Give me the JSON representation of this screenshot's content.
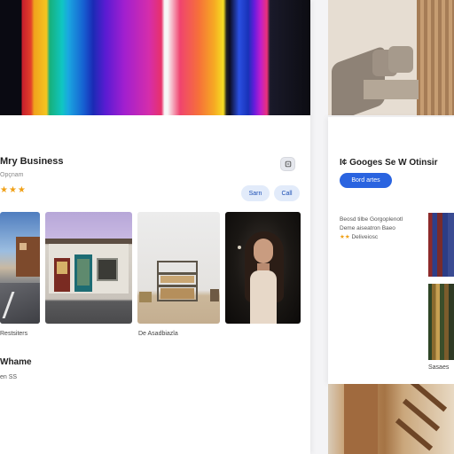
{
  "left_card": {
    "business_name": "Mry Business",
    "subtitle": "Opçnam",
    "rating_stars": "★★★",
    "save_label": "Sarn",
    "call_label": "Call",
    "photos": [
      {
        "name": "street-photo"
      },
      {
        "name": "storefront-photo"
      },
      {
        "name": "shelf-room-photo"
      },
      {
        "name": "portrait-photo"
      }
    ],
    "caption_1": "Restsiters",
    "caption_2": "De Asadbiazla",
    "section_title": "Whame",
    "section_sub": "en SS"
  },
  "right_card": {
    "title": "I¢ Googes Se W Otinsir",
    "button_label": "Bord artes",
    "info_line_1": "Beosd tilbe  Gorgoplenotl",
    "info_line_2": "Deme aiseatron  Baeo",
    "info_line_3_stars": "★★",
    "info_line_3_text": "Deliveiosc",
    "caption": "Sasaes"
  },
  "colors": {
    "accent_blue": "#2a64e0",
    "star_gold": "#f0a016",
    "pill_bg": "#e2ebfa"
  }
}
